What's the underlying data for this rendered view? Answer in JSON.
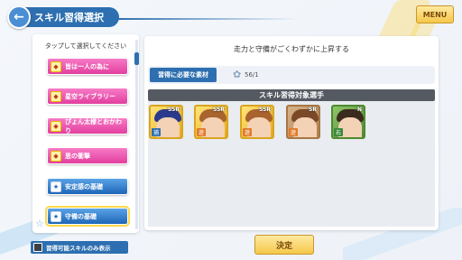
{
  "header": {
    "title": "スキル習得選択",
    "menu_label": "MENU"
  },
  "left_panel": {
    "hint": "タップして選択してください",
    "skills": [
      {
        "label": "皆は一人の為に",
        "style": "pink"
      },
      {
        "label": "星空ライブラリー",
        "style": "pink"
      },
      {
        "label": "ぴょん太様とおかわり",
        "style": "pink"
      },
      {
        "label": "思の衝撃",
        "style": "pink"
      },
      {
        "label": "安定感の基礎",
        "style": "blue"
      },
      {
        "label": "守備の基礎",
        "style": "blue",
        "selected": true
      }
    ]
  },
  "main": {
    "description": "走力と守備がごくわずかに上昇する",
    "materials_label": "習得に必要な素材",
    "materials_count": "56/1",
    "target_header": "スキル習得対象選手",
    "cards": [
      {
        "rarity": "SSR",
        "position": "捕"
      },
      {
        "rarity": "SSR",
        "position": "遊"
      },
      {
        "rarity": "SSR",
        "position": "遊"
      },
      {
        "rarity": "SR",
        "position": "遊"
      },
      {
        "rarity": "N",
        "position": "右"
      }
    ]
  },
  "footer": {
    "toggle_label": "習得可能スキルのみ表示",
    "decide_label": "決定"
  }
}
